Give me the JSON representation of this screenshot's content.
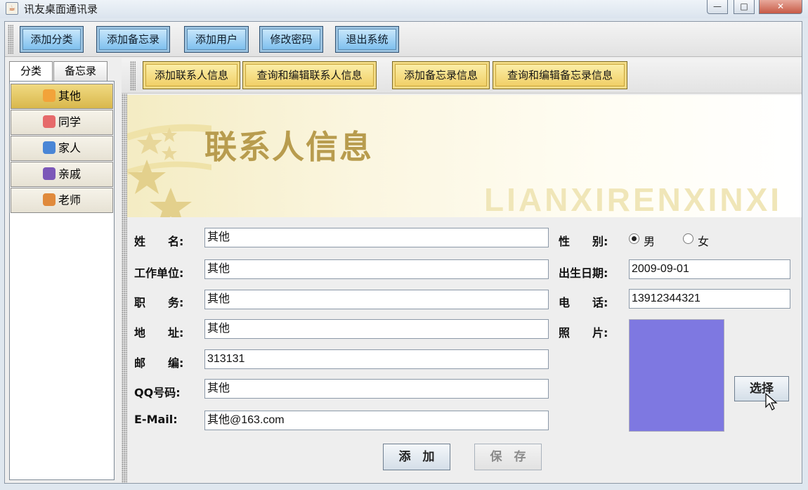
{
  "window": {
    "title": "讯友桌面通讯录",
    "controls": [
      "—",
      "□",
      "✕"
    ]
  },
  "toolbar": {
    "buttons": [
      "添加分类",
      "添加备忘录",
      "添加用户",
      "修改密码",
      "退出系统"
    ]
  },
  "left_tabs": [
    "分类",
    "备忘录"
  ],
  "categories": [
    {
      "label": "其他",
      "selected": true,
      "icon": "person-icon"
    },
    {
      "label": "同学",
      "selected": false,
      "icon": "group-icon"
    },
    {
      "label": "家人",
      "selected": false,
      "icon": "family-icon"
    },
    {
      "label": "亲戚",
      "selected": false,
      "icon": "relatives-icon"
    },
    {
      "label": "老师",
      "selected": false,
      "icon": "teacher-icon"
    }
  ],
  "subtoolbar": {
    "buttons": [
      "添加联系人信息",
      "查询和编辑联系人信息",
      "添加备忘录信息",
      "查询和编辑备忘录信息"
    ]
  },
  "banner": {
    "title": "联系人信息",
    "subtitle": "LIANXIRENXINXI"
  },
  "form": {
    "name_label": "姓　　名:",
    "name_value": "其他",
    "work_label": "工作单位:",
    "work_value": "其他",
    "position_label": "职　　务:",
    "position_value": "其他",
    "address_label": "地　　址:",
    "address_value": "其他",
    "zip_label": "邮　　编:",
    "zip_value": "313131",
    "qq_label": "QQ号码:",
    "qq_value": "其他",
    "email_label": "E-Mail:",
    "email_value": "其他@163.com",
    "gender_label": "性　　别:",
    "gender_male": "男",
    "gender_female": "女",
    "gender_selected": "男",
    "birth_label": "出生日期:",
    "birth_value": "2009-09-01",
    "phone_label": "电　　话:",
    "phone_value": "13912344321",
    "photo_label": "照　　片:",
    "photo_color": "#7e78e1",
    "choose_button": "选择",
    "add_button": "添　加",
    "save_button": "保　存"
  },
  "colors": {
    "toolbar_button": "#7fc0ee",
    "subtoolbar_button": "#f1d067",
    "selected_category": "#d9b84c",
    "banner_title": "#b89c4e"
  }
}
